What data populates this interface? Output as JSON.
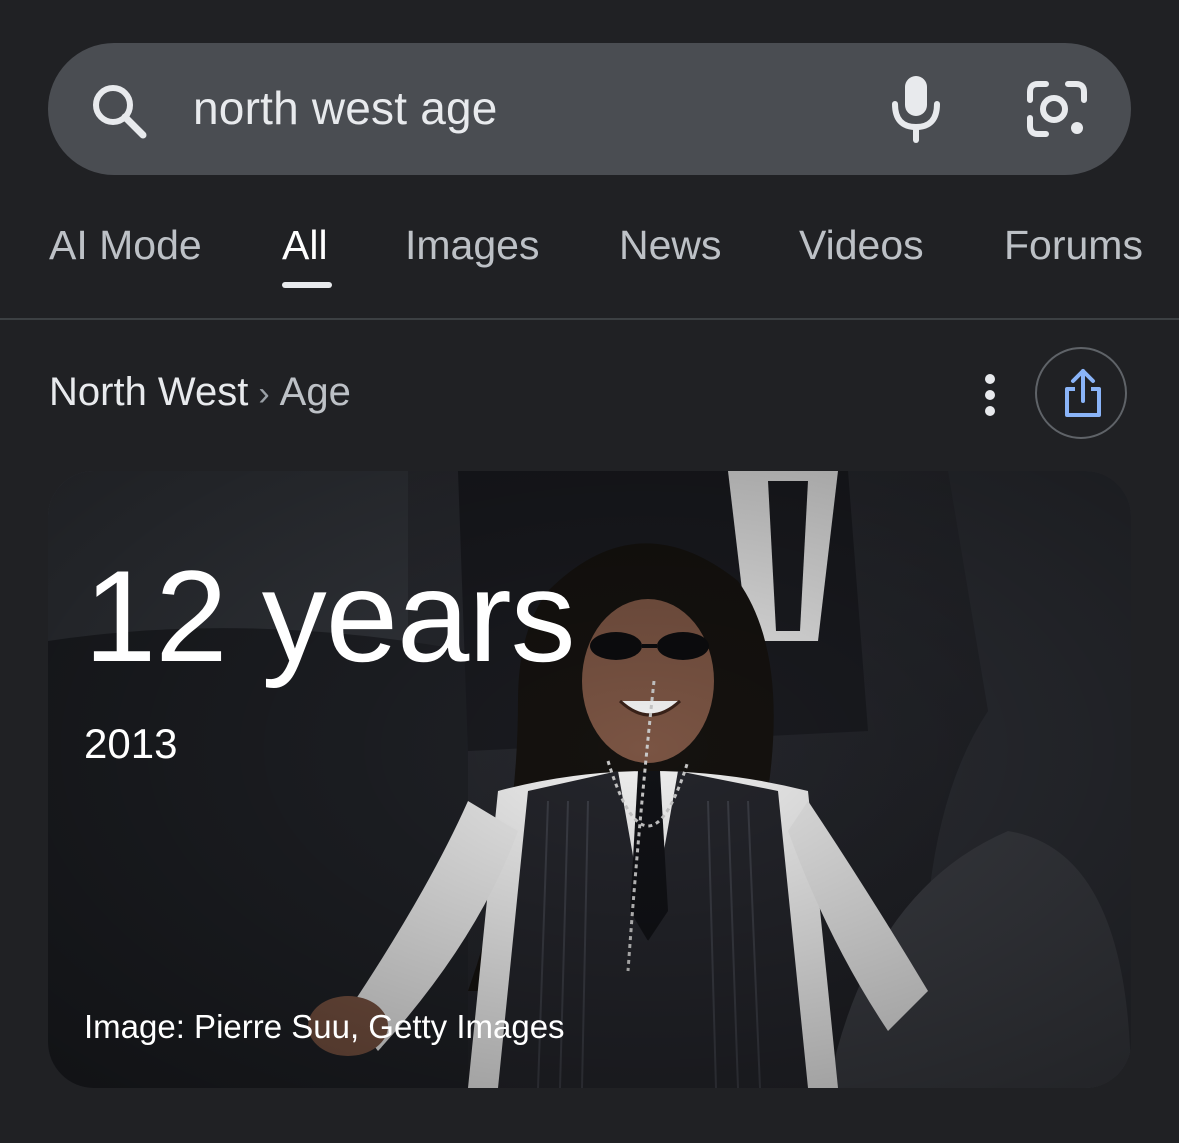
{
  "search": {
    "query": "north west age",
    "icons": [
      "search-icon",
      "mic-icon",
      "lens-icon"
    ]
  },
  "tabs": [
    {
      "label": "AI Mode",
      "active": false
    },
    {
      "label": "All",
      "active": true
    },
    {
      "label": "Images",
      "active": false
    },
    {
      "label": "News",
      "active": false
    },
    {
      "label": "Videos",
      "active": false
    },
    {
      "label": "Forums",
      "active": false
    }
  ],
  "breadcrumb": {
    "entity": "North West",
    "separator": "›",
    "attribute": "Age"
  },
  "result": {
    "age": "12 years",
    "birth_year": "2013",
    "image_credit": "Image: Pierre Suu, Getty Images"
  },
  "colors": {
    "background": "#202124",
    "search_bar": "#4a4d52",
    "share_icon": "#8ab4f8",
    "text": "#e8eaed"
  }
}
